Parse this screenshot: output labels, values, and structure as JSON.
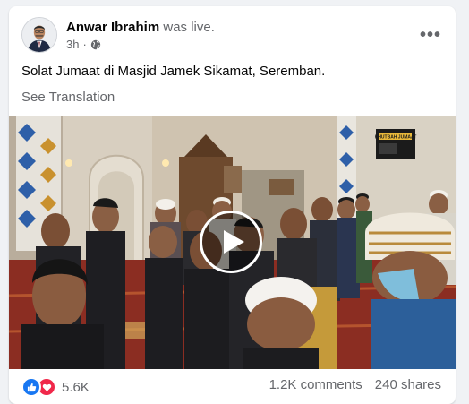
{
  "post": {
    "author": "Anwar Ibrahim",
    "status_text": "was live.",
    "time": "3h",
    "privacy_icon": "globe-icon",
    "more_icon": "more-options-icon",
    "text": "Solat Jumaat di Masjid Jamek Sikamat, Seremban.",
    "translate_label": "See Translation"
  },
  "video": {
    "play_icon": "play-icon",
    "tv_sign": "KHUTBAH JUMAAT"
  },
  "footer": {
    "reaction_icons": [
      "like-icon",
      "love-icon"
    ],
    "reaction_count": "5.6K",
    "comments": "1.2K comments",
    "shares": "240 shares"
  },
  "colors": {
    "accent": "#1877f2",
    "love": "#f0284a",
    "secondary_text": "#65676b"
  }
}
